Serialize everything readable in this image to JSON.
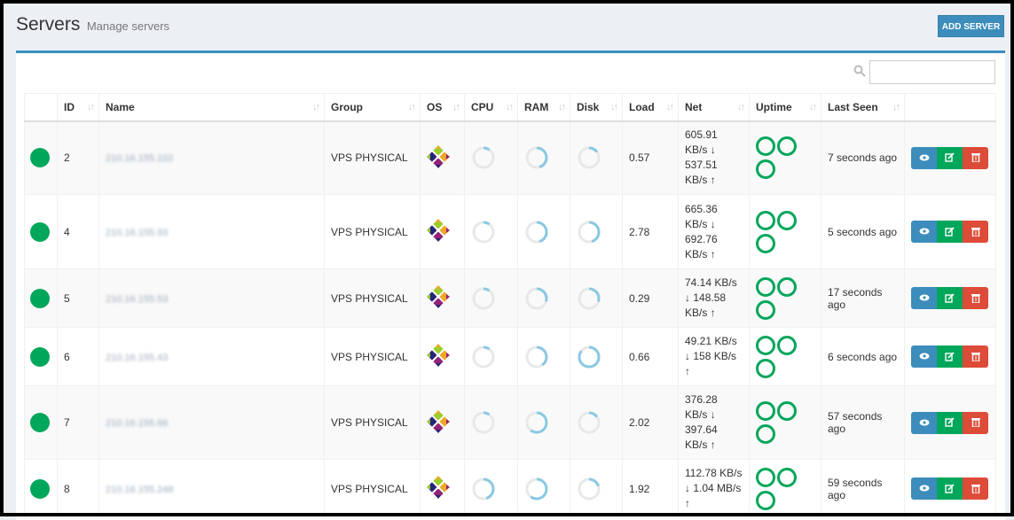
{
  "page": {
    "title": "Servers",
    "subtitle": "Manage servers",
    "add_button": "ADD SERVER"
  },
  "icons": {
    "search": "search-icon",
    "os": "centos-logo-icon",
    "view": "eye-icon",
    "edit": "edit-icon",
    "delete": "trash-icon",
    "status": "status-online-dot",
    "sort": "sort-arrows-icon"
  },
  "colors": {
    "accent": "#3c8dbc",
    "online": "#00a65a",
    "danger": "#dd4b39",
    "ring": "#89c8e3",
    "ring_track": "#e8e8e8"
  },
  "table": {
    "headers": [
      "",
      "ID",
      "Name",
      "Group",
      "OS",
      "CPU",
      "RAM",
      "Disk",
      "Load",
      "Net",
      "Uptime",
      "Last Seen",
      ""
    ],
    "rows": [
      {
        "id": "2",
        "name": "210.16.155.102",
        "group": "VPS PHYSICAL",
        "cpu": 0.1,
        "ram": 0.45,
        "disk": 0.15,
        "load": "0.57",
        "net_down": "605.91 KB/s",
        "net_up": "537.51 KB/s",
        "uptime_rings": 3,
        "last_seen": "7 seconds ago"
      },
      {
        "id": "4",
        "name": "210.16.155.93",
        "group": "VPS PHYSICAL",
        "cpu": 0.1,
        "ram": 0.45,
        "disk": 0.45,
        "load": "2.78",
        "net_down": "665.36 KB/s",
        "net_up": "692.76 KB/s",
        "uptime_rings": 3,
        "last_seen": "5 seconds ago"
      },
      {
        "id": "5",
        "name": "210.16.155.53",
        "group": "VPS PHYSICAL",
        "cpu": 0.1,
        "ram": 0.3,
        "disk": 0.3,
        "load": "0.29",
        "net_down": "74.14 KB/s",
        "net_up": "148.58 KB/s",
        "uptime_rings": 3,
        "last_seen": "17 seconds ago"
      },
      {
        "id": "6",
        "name": "210.16.155.43",
        "group": "VPS PHYSICAL",
        "cpu": 0.1,
        "ram": 0.4,
        "disk": 0.85,
        "load": "0.66",
        "net_down": "49.21 KB/s",
        "net_up": "158 KB/s",
        "uptime_rings": 3,
        "last_seen": "6 seconds ago"
      },
      {
        "id": "7",
        "name": "210.16.155.66",
        "group": "VPS PHYSICAL",
        "cpu": 0.1,
        "ram": 0.6,
        "disk": 0.15,
        "load": "2.02",
        "net_down": "376.28 KB/s",
        "net_up": "397.64 KB/s",
        "uptime_rings": 3,
        "last_seen": "57 seconds ago"
      },
      {
        "id": "8",
        "name": "210.16.155.248",
        "group": "VPS PHYSICAL",
        "cpu": 0.45,
        "ram": 0.6,
        "disk": 0.2,
        "load": "1.92",
        "net_down": "112.78 KB/s",
        "net_up": "1.04 MB/s",
        "uptime_rings": 3,
        "last_seen": "59 seconds ago"
      }
    ]
  }
}
